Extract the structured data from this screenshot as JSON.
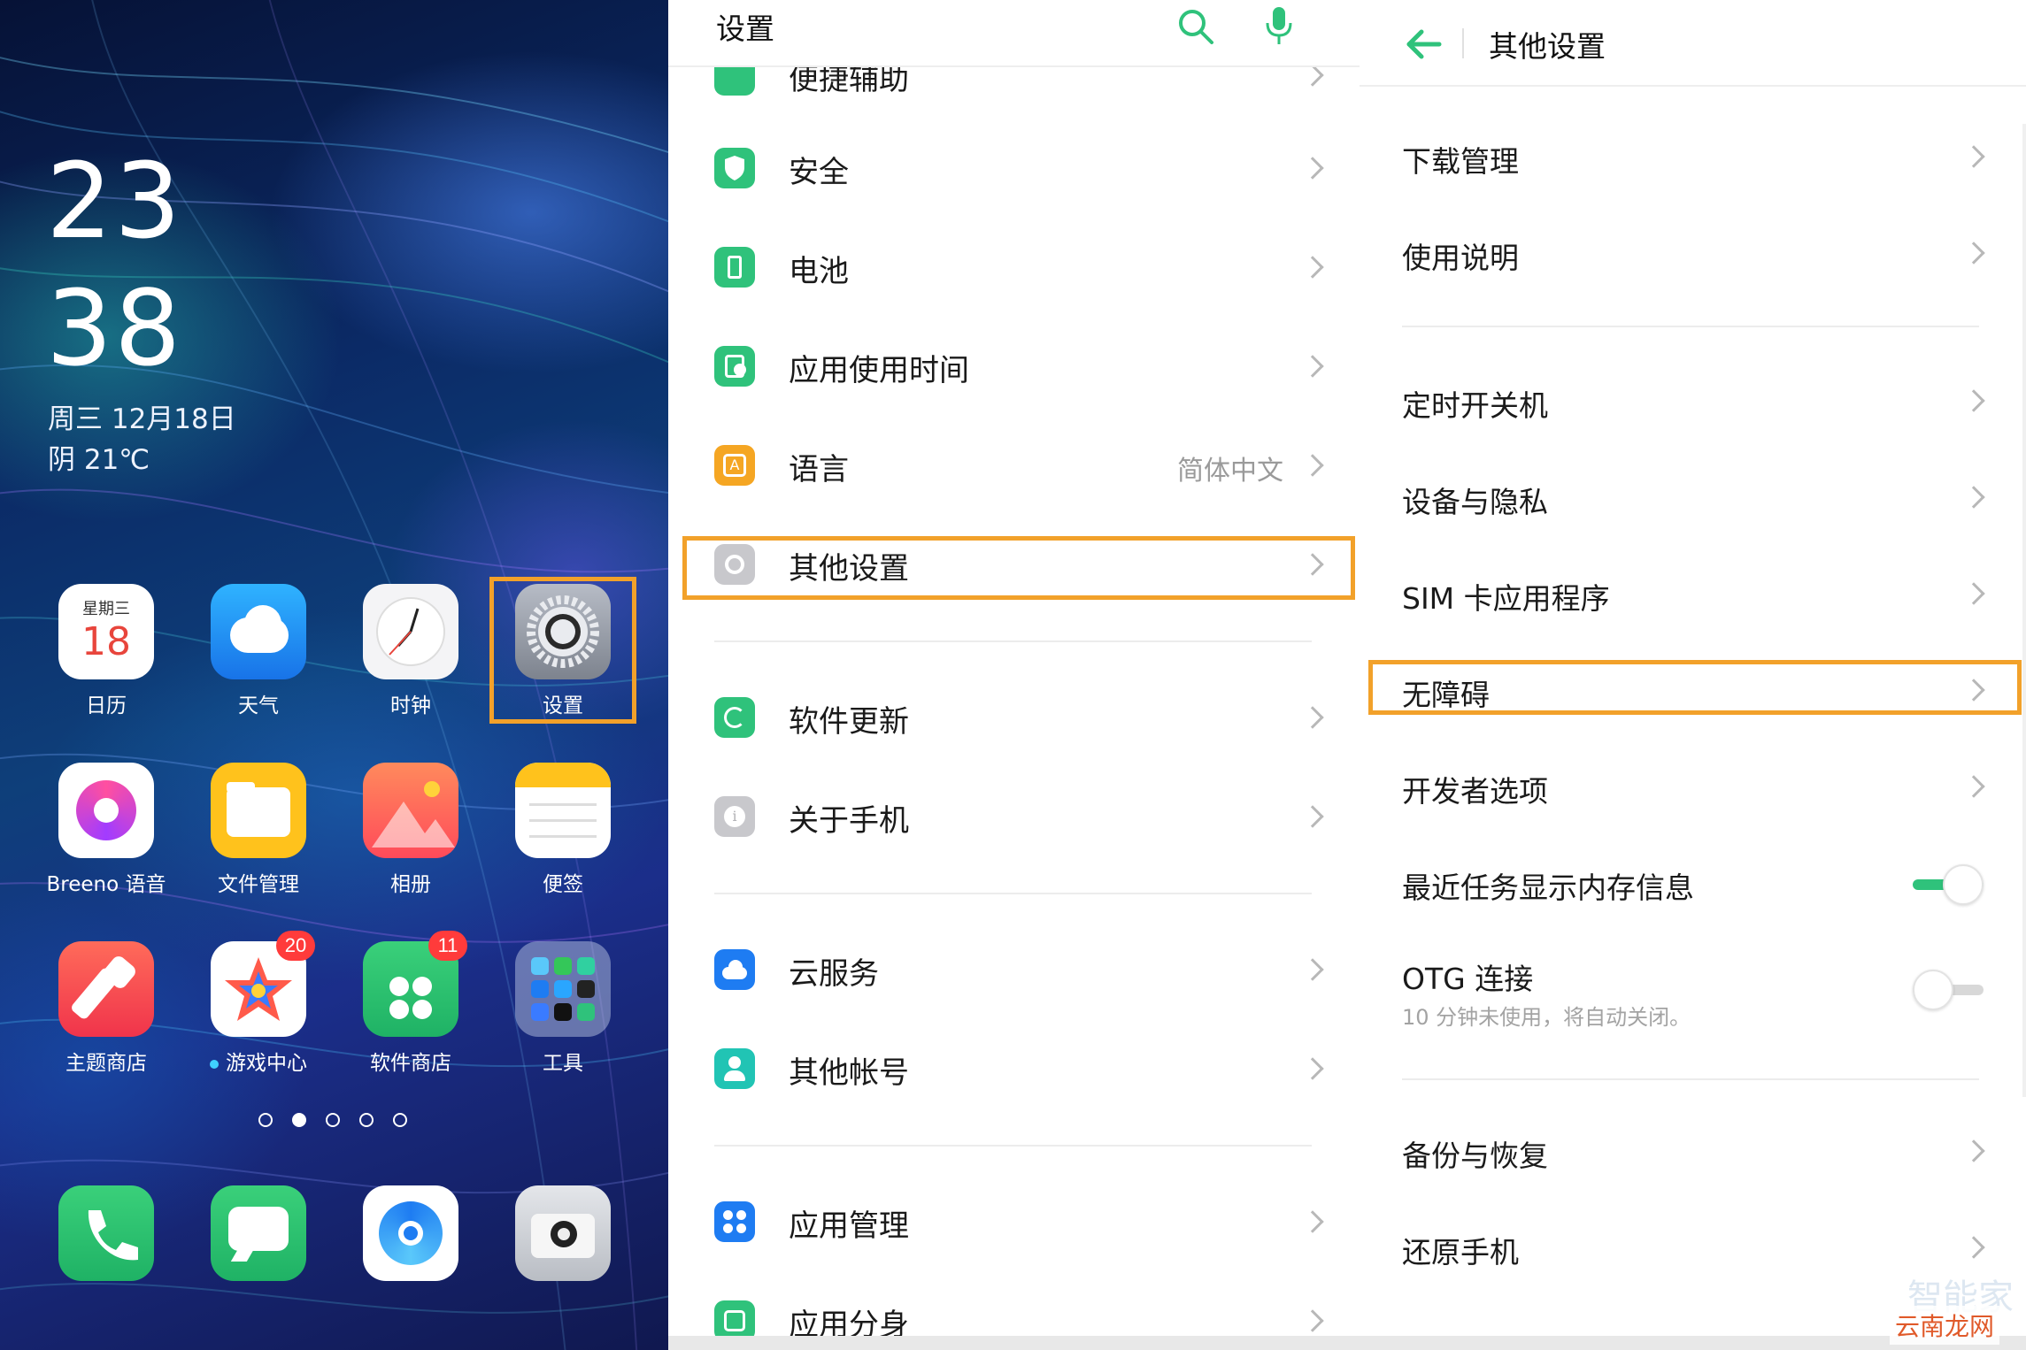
{
  "home": {
    "clock_hour": "23",
    "clock_minute": "38",
    "date": "周三  12月18日",
    "weather": "阴 21℃",
    "apps_row1": [
      {
        "label": "日历",
        "icon": "calendar-icon",
        "cal_weekday": "星期三",
        "cal_day": "18"
      },
      {
        "label": "天气",
        "icon": "weather-icon"
      },
      {
        "label": "时钟",
        "icon": "clock-icon"
      },
      {
        "label": "设置",
        "icon": "settings-gear-icon"
      }
    ],
    "apps_row2": [
      {
        "label": "Breeno 语音",
        "icon": "breeno-icon"
      },
      {
        "label": "文件管理",
        "icon": "folder-icon"
      },
      {
        "label": "相册",
        "icon": "photos-icon"
      },
      {
        "label": "便签",
        "icon": "notes-icon"
      }
    ],
    "apps_row3": [
      {
        "label": "主题商店",
        "icon": "theme-brush-icon"
      },
      {
        "label": "游戏中心",
        "icon": "game-star-icon",
        "badge": "20"
      },
      {
        "label": "软件商店",
        "icon": "app-store-icon",
        "badge": "11"
      },
      {
        "label": "工具",
        "icon": "tools-folder-icon"
      }
    ],
    "dock": [
      {
        "icon": "phone-icon"
      },
      {
        "icon": "messages-icon"
      },
      {
        "icon": "browser-icon"
      },
      {
        "icon": "camera-icon"
      }
    ],
    "page_dots": 5,
    "active_dot": 1
  },
  "settings": {
    "title": "设置",
    "partial_top_item": "便捷辅助",
    "items": [
      {
        "label": "安全",
        "icon": "shield-icon",
        "color": "#2fc27b"
      },
      {
        "label": "电池",
        "icon": "battery-icon",
        "color": "#2fc27b"
      },
      {
        "label": "应用使用时间",
        "icon": "app-timer-icon",
        "color": "#2fc27b"
      },
      {
        "label": "语言",
        "icon": "language-icon",
        "color": "#f5a623",
        "value": "简体中文"
      },
      {
        "label": "其他设置",
        "icon": "other-settings-icon",
        "color": "#c8c8cc"
      },
      {
        "label": "软件更新",
        "icon": "update-icon",
        "color": "#2fc27b"
      },
      {
        "label": "关于手机",
        "icon": "info-icon",
        "color": "#c8c8cc"
      },
      {
        "label": "云服务",
        "icon": "cloud-icon",
        "color": "#1e7cf2"
      },
      {
        "label": "其他帐号",
        "icon": "account-icon",
        "color": "#21c4b4"
      },
      {
        "label": "应用管理",
        "icon": "app-manage-icon",
        "color": "#1e7cf2"
      },
      {
        "label": "应用分身",
        "icon": "app-clone-icon",
        "color": "#2fc27b"
      }
    ]
  },
  "other": {
    "title": "其他设置",
    "items": [
      {
        "label": "下载管理"
      },
      {
        "label": "使用说明"
      },
      {
        "label": "定时开关机"
      },
      {
        "label": "设备与隐私"
      },
      {
        "label": "SIM 卡应用程序"
      },
      {
        "label": "无障碍"
      },
      {
        "label": "开发者选项"
      },
      {
        "label": "最近任务显示内存信息",
        "toggle": "on"
      },
      {
        "label": "OTG 连接",
        "sub": "10 分钟未使用，将自动关闭。",
        "toggle": "off"
      },
      {
        "label": "备份与恢复"
      },
      {
        "label": "还原手机"
      }
    ]
  },
  "colors": {
    "accent_green": "#2fc27b",
    "highlight_orange": "#f2a12a"
  },
  "watermark": "云南龙网",
  "watermark_faint": "智能家"
}
